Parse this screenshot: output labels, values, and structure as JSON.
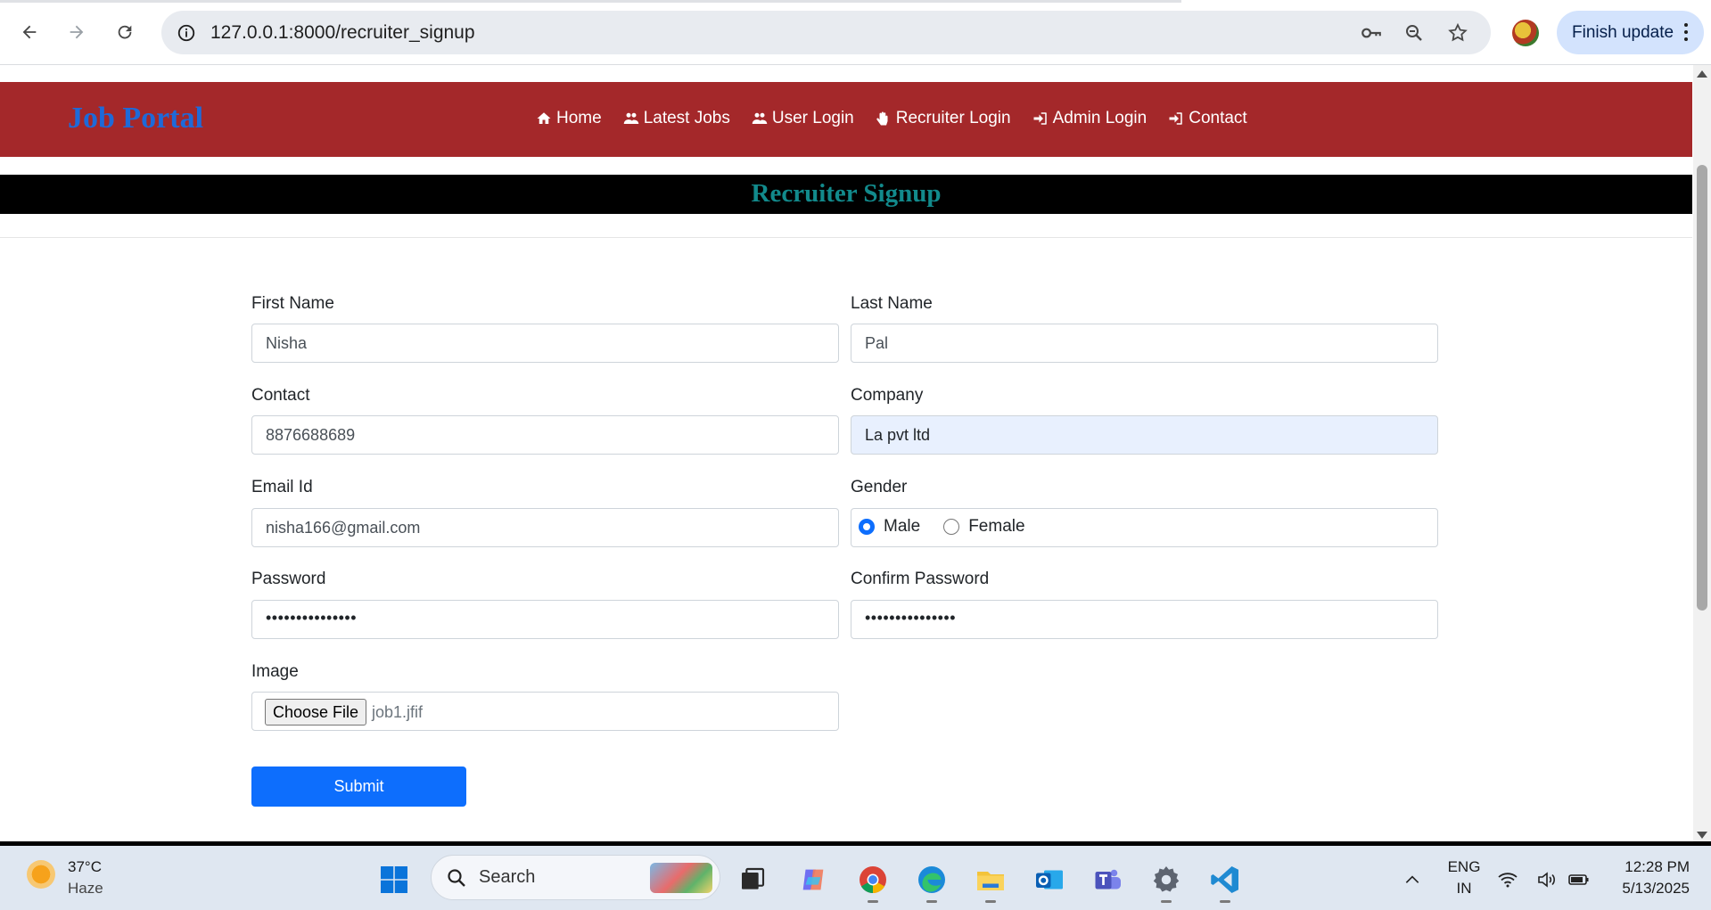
{
  "browser": {
    "url": "127.0.0.1:8000/recruiter_signup",
    "finish_update_label": "Finish update"
  },
  "site": {
    "brand": "Job Portal",
    "nav": [
      {
        "label": "Home",
        "icon": "home-icon"
      },
      {
        "label": "Latest Jobs",
        "icon": "users-icon"
      },
      {
        "label": "User Login",
        "icon": "users-icon"
      },
      {
        "label": "Recruiter Login",
        "icon": "hand-icon"
      },
      {
        "label": "Admin Login",
        "icon": "sign-in-icon"
      },
      {
        "label": "Contact",
        "icon": "sign-in-icon"
      }
    ],
    "page_title": "Recruiter Signup"
  },
  "form": {
    "first_name": {
      "label": "First Name",
      "value": "Nisha"
    },
    "last_name": {
      "label": "Last Name",
      "value": "Pal"
    },
    "contact": {
      "label": "Contact",
      "value": "8876688689"
    },
    "company": {
      "label": "Company",
      "value": "La pvt ltd"
    },
    "email": {
      "label": "Email Id",
      "value": "nisha166@gmail.com"
    },
    "gender": {
      "label": "Gender",
      "options": [
        "Male",
        "Female"
      ],
      "selected": "Male"
    },
    "password": {
      "label": "Password",
      "masked": "•••••••••••••••"
    },
    "confirm_password": {
      "label": "Confirm Password",
      "masked": "•••••••••••••••"
    },
    "image": {
      "label": "Image",
      "button_label": "Choose File",
      "file_name": "job1.jfif"
    },
    "submit_label": "Submit"
  },
  "taskbar": {
    "weather_temp": "37°C",
    "weather_desc": "Haze",
    "search_label": "Search",
    "lang_line1": "ENG",
    "lang_line2": "IN",
    "time": "12:28 PM",
    "date": "5/13/2025"
  },
  "colors": {
    "navbar_bg": "#a4282a",
    "brand": "#1e6ad9",
    "title_bar_bg": "#000000",
    "title_text": "#128a8c",
    "submit_bg": "#0d6efd",
    "autofill_bg": "#e8f0fe"
  }
}
